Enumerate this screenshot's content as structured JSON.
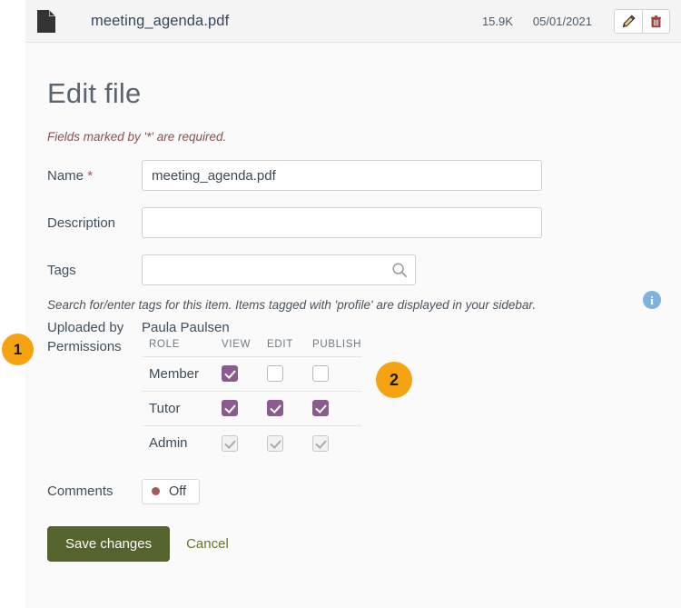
{
  "file_header": {
    "icon": "file-document-icon",
    "name": "meeting_agenda.pdf",
    "size": "15.9K",
    "date": "05/01/2021",
    "edit_icon": "pencil-icon",
    "delete_icon": "trash-icon"
  },
  "page": {
    "title": "Edit file",
    "required_note": "Fields marked by '*' are required."
  },
  "form": {
    "name": {
      "label": "Name",
      "required_marker": "*",
      "value": "meeting_agenda.pdf",
      "placeholder": ""
    },
    "description": {
      "label": "Description",
      "value": "",
      "placeholder": ""
    },
    "tags": {
      "label": "Tags",
      "value": "",
      "placeholder": "",
      "icon": "search-icon",
      "help_text": "Search for/enter tags for this item. Items tagged with 'profile' are displayed in your sidebar."
    },
    "info_icon": {
      "glyph": "i",
      "name": "info-icon",
      "color": "#7fb2dd"
    },
    "uploaded_by": {
      "label": "Uploaded by",
      "value": "Paula Paulsen"
    },
    "permissions": {
      "label": "Permissions",
      "columns": [
        "ROLE",
        "VIEW",
        "EDIT",
        "PUBLISH"
      ],
      "rows": [
        {
          "role": "Member",
          "view": "checked",
          "edit": "unchecked",
          "publish": "unchecked",
          "disabled": false
        },
        {
          "role": "Tutor",
          "view": "checked",
          "edit": "checked",
          "publish": "checked",
          "disabled": false
        },
        {
          "role": "Admin",
          "view": "checked",
          "edit": "checked",
          "publish": "checked",
          "disabled": true
        }
      ]
    },
    "comments": {
      "label": "Comments",
      "state_label": "Off",
      "dot_color": "#a05a5a"
    }
  },
  "actions": {
    "save_label": "Save changes",
    "cancel_label": "Cancel",
    "save_color": "#55632c"
  },
  "callouts": [
    {
      "number": "1"
    },
    {
      "number": "2"
    }
  ],
  "colors": {
    "checkbox_on": "#8b5b90",
    "callout": "#f5a311",
    "required_text": "#8a5252"
  }
}
